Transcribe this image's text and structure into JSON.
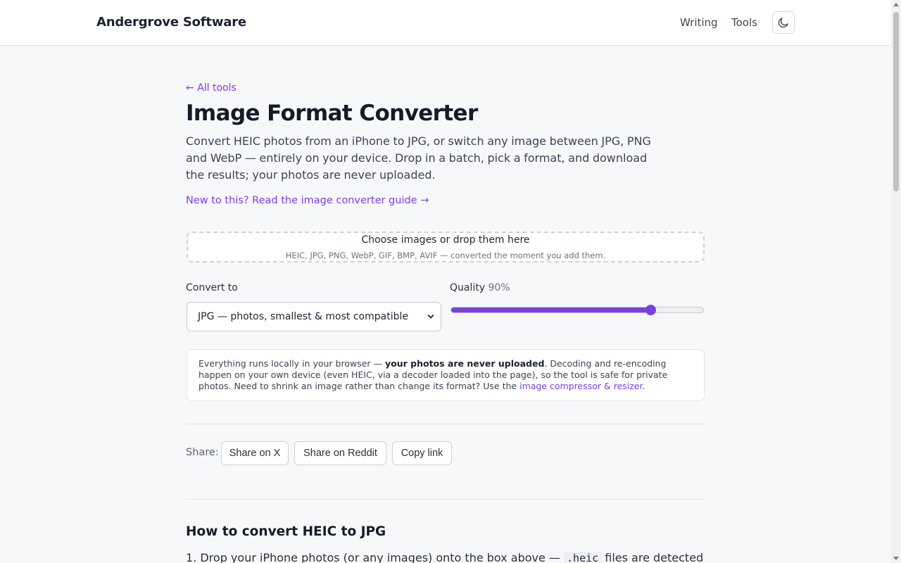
{
  "header": {
    "brand": "Andergrove Software",
    "nav": [
      "Writing",
      "Tools"
    ],
    "theme_icon": "moon-icon"
  },
  "back_link": "← All tools",
  "title": "Image Format Converter",
  "intro": "Convert HEIC photos from an iPhone to JPG, or switch any image between JPG, PNG and WebP — entirely on your device. Drop in a batch, pick a format, and download the results; your photos are never uploaded.",
  "guide_link": "New to this? Read the image converter guide →",
  "dropzone": {
    "title": "Choose images or drop them here",
    "subtitle": "HEIC, JPG, PNG, WebP, GIF, BMP, AVIF — converted the moment you add them."
  },
  "convert": {
    "label": "Convert to",
    "selected": "JPG — photos, smallest & most compatible"
  },
  "quality": {
    "label": "Quality",
    "value_text": "90%",
    "value": 0.79
  },
  "note": {
    "part1": "Everything runs locally in your browser — ",
    "bold": "your photos are never uploaded",
    "part2": ". Decoding and re-encoding happen on your own device (even HEIC, via a decoder loaded into the page), so the tool is safe for private photos. Need to shrink an image rather than change its format? Use the ",
    "link": "image compressor & resizer",
    "part3": "."
  },
  "share": {
    "label": "Share:",
    "buttons": [
      "Share on X",
      "Share on Reddit",
      "Copy link"
    ]
  },
  "howto": {
    "title": "How to convert HEIC to JPG",
    "step1_start": "1. Drop your iPhone photos (or any images) onto the box above — ",
    "step1_code": ".heic",
    "step1_end": " files are detected"
  },
  "colors": {
    "accent": "#7a3fe0",
    "text": "#1f2430",
    "background": "#f7f8fa"
  }
}
